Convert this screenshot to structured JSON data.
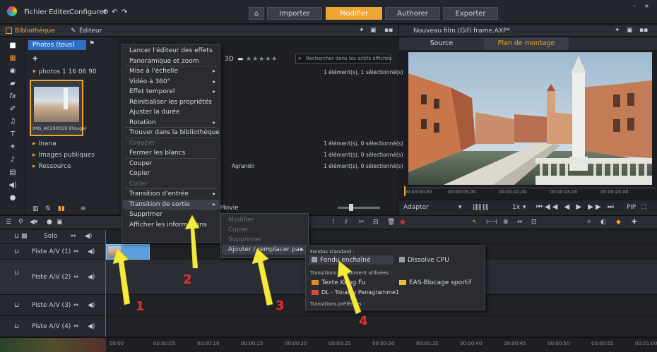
{
  "menubar": {
    "file": "Fichier",
    "edit": "Editer",
    "configure": "Configurer"
  },
  "tabs": {
    "import": "Importer",
    "edit": "Modifier",
    "author": "Authorer",
    "export": "Exporter"
  },
  "library": {
    "tab_library": "Bibliothèque",
    "tab_editor": "Éditeur",
    "photos_tab": "Photos (tous)",
    "rating_prefix": "3D",
    "search_placeholder": "Rechercher dans les actifs affichés",
    "tree": {
      "folder": "photos 1 16 06 90",
      "thumb_caption": "IMG_A0190019 (Rouge)",
      "item1": "Inana",
      "item2": "Images publiques",
      "item3": "Ressource",
      "item3_extra": "Agrandir"
    },
    "counts": [
      "1 élément(s), 1 sélectionné(s)",
      "1 élément(s), 0 sélectionné(s)",
      "1 élément(s), 0 sélectionné(s)",
      "1 élément(s), 0 sélectionné(s)"
    ],
    "movie_label": "Movie"
  },
  "preview": {
    "title": "Nouveau film (Gif) frame.AXP*",
    "tab_source": "Source",
    "tab_timeline": "Plan de montage",
    "time_marks": [
      "00:00:00,00",
      "00:00:05,00",
      "00:00:10,00",
      "00:00:15,00",
      "00:00:20,00"
    ],
    "fit_label": "Adapter",
    "speed": "1x"
  },
  "timeline": {
    "tracks": [
      {
        "label": "Solo"
      },
      {
        "label": "Piste A/V (1)"
      },
      {
        "label": "Piste A/V (2)"
      },
      {
        "label": "Piste A/V (3)"
      },
      {
        "label": "Piste A/V (4)"
      }
    ],
    "ruler": [
      "00:00",
      "00:00:05",
      "00:00:10",
      "00:00:15",
      "00:00:20",
      "00:00:25",
      "00:00:30",
      "00:00:35",
      "00:00:40",
      "00:00:45",
      "00:00:50",
      "00:00:55",
      "00:01:00"
    ]
  },
  "context_menu": {
    "items": [
      {
        "label": "Lancer l'éditeur des effets",
        "disabled": false,
        "submenu": false
      },
      {
        "label": "Panoramique et zoom",
        "disabled": false,
        "submenu": false
      },
      {
        "label": "Mise à l'échelle",
        "disabled": false,
        "submenu": true
      },
      {
        "label": "Vidéo à 360°",
        "disabled": false,
        "submenu": true
      },
      {
        "label": "Effet temporel",
        "disabled": false,
        "submenu": true
      },
      {
        "label": "Réinitialiser les propriétés",
        "disabled": false,
        "submenu": false
      },
      {
        "label": "Ajuster la durée",
        "disabled": false,
        "submenu": false
      },
      {
        "label": "Rotation",
        "disabled": false,
        "submenu": true
      },
      {
        "label": "Trouver dans la bibliothèque",
        "disabled": false,
        "submenu": false
      },
      {
        "label": "Grouper",
        "disabled": true,
        "submenu": false
      },
      {
        "label": "Fermer les blancs",
        "disabled": false,
        "submenu": false
      },
      {
        "label": "Couper",
        "disabled": false,
        "submenu": false
      },
      {
        "label": "Copier",
        "disabled": false,
        "submenu": false
      },
      {
        "label": "Coller",
        "disabled": true,
        "submenu": false
      },
      {
        "label": "Transition d'entrée",
        "disabled": false,
        "submenu": true
      },
      {
        "label": "Transition de sortie",
        "disabled": false,
        "submenu": true
      },
      {
        "label": "Supprimer",
        "disabled": false,
        "submenu": false
      },
      {
        "label": "Afficher les informations",
        "disabled": false,
        "submenu": false
      }
    ]
  },
  "submenu2": {
    "items": [
      {
        "label": "Modifier",
        "disabled": true
      },
      {
        "label": "Copier",
        "disabled": true
      },
      {
        "label": "Supprimer",
        "disabled": true
      },
      {
        "label": "Ajouter / remplacer par",
        "disabled": false
      }
    ]
  },
  "submenu3": {
    "section_standard": "Fondus standard :",
    "fade_black": "Fondu enchaîné",
    "dissolve": "Dissolve CPU",
    "section_recent": "Transitions récemment utilisées :",
    "t1": "Texte Kung Fu",
    "t2": "EAS-Blocage sportif",
    "t3": "DL - Tonality Panagramme1",
    "section_favorites": "Transitions préférées :"
  },
  "callouts": [
    "1",
    "2",
    "3",
    "4"
  ],
  "colors": {
    "accent": "#f0a431",
    "arrow": "#f5ea3c",
    "callout": "#e5302a"
  }
}
